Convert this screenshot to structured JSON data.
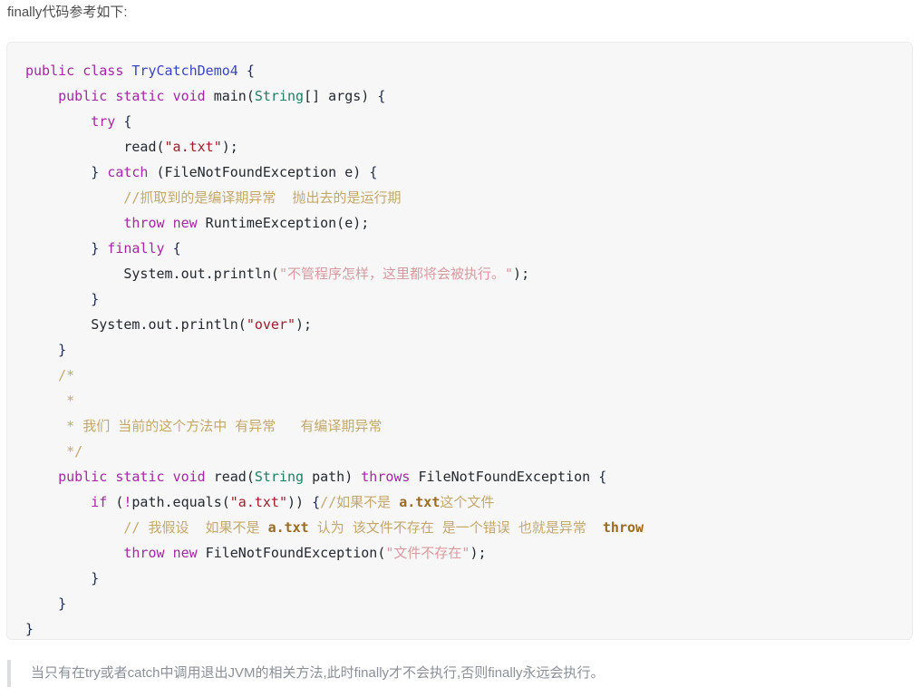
{
  "intro": {
    "text": "finally代码参考如下:"
  },
  "code_block": {
    "language": "java",
    "background_color": "#f7f7f8",
    "border_color": "#ececef",
    "colors": {
      "keyword": "#a626a4",
      "type_declaration": "#3b44c4",
      "builtin_type": "#1e8063",
      "string": "#a21b2b",
      "string_cjk": "#d99a9f",
      "comment": "#c4a86a",
      "comment_emphasis": "#9a6b23",
      "plain": "#24292e",
      "brace": "#1c2b4a"
    },
    "lines": [
      {
        "id": "line-1",
        "tokens": [
          {
            "t": "public",
            "c": "kw"
          },
          {
            "t": " ",
            "c": "pl"
          },
          {
            "t": "class",
            "c": "kw"
          },
          {
            "t": " ",
            "c": "pl"
          },
          {
            "t": "TryCatchDemo4",
            "c": "typ"
          },
          {
            "t": " ",
            "c": "pl"
          },
          {
            "t": "{",
            "c": "br"
          }
        ]
      },
      {
        "id": "line-2",
        "tokens": [
          {
            "t": "    ",
            "c": "pl"
          },
          {
            "t": "public",
            "c": "kw"
          },
          {
            "t": " ",
            "c": "pl"
          },
          {
            "t": "static",
            "c": "kw"
          },
          {
            "t": " ",
            "c": "pl"
          },
          {
            "t": "void",
            "c": "kw"
          },
          {
            "t": " ",
            "c": "pl"
          },
          {
            "t": "main",
            "c": "pl"
          },
          {
            "t": "(",
            "c": "pl"
          },
          {
            "t": "String",
            "c": "bi"
          },
          {
            "t": "[] args) ",
            "c": "pl"
          },
          {
            "t": "{",
            "c": "br"
          }
        ]
      },
      {
        "id": "line-3",
        "tokens": [
          {
            "t": "        ",
            "c": "pl"
          },
          {
            "t": "try",
            "c": "kw"
          },
          {
            "t": " ",
            "c": "pl"
          },
          {
            "t": "{",
            "c": "br"
          }
        ]
      },
      {
        "id": "line-4",
        "tokens": [
          {
            "t": "            read(",
            "c": "pl"
          },
          {
            "t": "\"a.txt\"",
            "c": "str"
          },
          {
            "t": ");",
            "c": "pl"
          }
        ]
      },
      {
        "id": "line-5",
        "tokens": [
          {
            "t": "        ",
            "c": "pl"
          },
          {
            "t": "}",
            "c": "br"
          },
          {
            "t": " ",
            "c": "pl"
          },
          {
            "t": "catch",
            "c": "kw"
          },
          {
            "t": " (FileNotFoundException e) ",
            "c": "pl"
          },
          {
            "t": "{",
            "c": "br"
          }
        ]
      },
      {
        "id": "line-6",
        "tokens": [
          {
            "t": "            ",
            "c": "pl"
          },
          {
            "t": "//抓取到的是编译期异常  抛出去的是运行期",
            "c": "cmt"
          }
        ]
      },
      {
        "id": "line-7",
        "tokens": [
          {
            "t": "            ",
            "c": "pl"
          },
          {
            "t": "throw",
            "c": "kw"
          },
          {
            "t": " ",
            "c": "pl"
          },
          {
            "t": "new",
            "c": "kw"
          },
          {
            "t": " RuntimeException(e);",
            "c": "pl"
          }
        ]
      },
      {
        "id": "line-8",
        "tokens": [
          {
            "t": "        ",
            "c": "pl"
          },
          {
            "t": "}",
            "c": "br"
          },
          {
            "t": " ",
            "c": "pl"
          },
          {
            "t": "finally",
            "c": "kw"
          },
          {
            "t": " ",
            "c": "pl"
          },
          {
            "t": "{",
            "c": "br"
          }
        ]
      },
      {
        "id": "line-9",
        "tokens": [
          {
            "t": "            System.out.println(",
            "c": "pl"
          },
          {
            "t": "\"不管程序怎样，这里都将会被执行。\"",
            "c": "strc"
          },
          {
            "t": ");",
            "c": "pl"
          }
        ]
      },
      {
        "id": "line-10",
        "tokens": [
          {
            "t": "        ",
            "c": "pl"
          },
          {
            "t": "}",
            "c": "br"
          }
        ]
      },
      {
        "id": "line-11",
        "tokens": [
          {
            "t": "        System.out.println(",
            "c": "pl"
          },
          {
            "t": "\"over\"",
            "c": "str"
          },
          {
            "t": ");",
            "c": "pl"
          }
        ]
      },
      {
        "id": "line-12",
        "tokens": [
          {
            "t": "    ",
            "c": "pl"
          },
          {
            "t": "}",
            "c": "br"
          }
        ]
      },
      {
        "id": "line-13",
        "tokens": [
          {
            "t": "    ",
            "c": "pl"
          },
          {
            "t": "/*",
            "c": "cmt"
          }
        ]
      },
      {
        "id": "line-14",
        "tokens": [
          {
            "t": "     ",
            "c": "pl"
          },
          {
            "t": "*",
            "c": "cmt"
          }
        ]
      },
      {
        "id": "line-15",
        "tokens": [
          {
            "t": "     ",
            "c": "pl"
          },
          {
            "t": "* 我们 当前的这个方法中 有异常   有编译期异常",
            "c": "cmt"
          }
        ]
      },
      {
        "id": "line-16",
        "tokens": [
          {
            "t": "     ",
            "c": "pl"
          },
          {
            "t": "*/",
            "c": "cmt"
          }
        ]
      },
      {
        "id": "line-17",
        "tokens": [
          {
            "t": "    ",
            "c": "pl"
          },
          {
            "t": "public",
            "c": "kw"
          },
          {
            "t": " ",
            "c": "pl"
          },
          {
            "t": "static",
            "c": "kw"
          },
          {
            "t": " ",
            "c": "pl"
          },
          {
            "t": "void",
            "c": "kw"
          },
          {
            "t": " ",
            "c": "pl"
          },
          {
            "t": "read",
            "c": "pl"
          },
          {
            "t": "(",
            "c": "pl"
          },
          {
            "t": "String",
            "c": "bi"
          },
          {
            "t": " path) ",
            "c": "pl"
          },
          {
            "t": "throws",
            "c": "kw"
          },
          {
            "t": " FileNotFoundException ",
            "c": "pl"
          },
          {
            "t": "{",
            "c": "br"
          }
        ]
      },
      {
        "id": "line-18",
        "tokens": [
          {
            "t": "        ",
            "c": "pl"
          },
          {
            "t": "if",
            "c": "kw"
          },
          {
            "t": " (",
            "c": "pl"
          },
          {
            "t": "!",
            "c": "kw"
          },
          {
            "t": "path.equals(",
            "c": "pl"
          },
          {
            "t": "\"a.txt\"",
            "c": "str"
          },
          {
            "t": ")) ",
            "c": "pl"
          },
          {
            "t": "{",
            "c": "br"
          },
          {
            "t": "//如果不是 ",
            "c": "cmt"
          },
          {
            "t": "a.txt",
            "c": "cmtb"
          },
          {
            "t": "这个文件",
            "c": "cmt"
          }
        ]
      },
      {
        "id": "line-19",
        "tokens": [
          {
            "t": "            ",
            "c": "pl"
          },
          {
            "t": "// 我假设  如果不是 ",
            "c": "cmt"
          },
          {
            "t": "a.txt",
            "c": "cmtb"
          },
          {
            "t": " 认为 该文件不存在 是一个错误 也就是异常  ",
            "c": "cmt"
          },
          {
            "t": "throw",
            "c": "cmtb"
          }
        ]
      },
      {
        "id": "line-20",
        "tokens": [
          {
            "t": "            ",
            "c": "pl"
          },
          {
            "t": "throw",
            "c": "kw"
          },
          {
            "t": " ",
            "c": "pl"
          },
          {
            "t": "new",
            "c": "kw"
          },
          {
            "t": " FileNotFoundException(",
            "c": "pl"
          },
          {
            "t": "\"文件不存在\"",
            "c": "strc"
          },
          {
            "t": ");",
            "c": "pl"
          }
        ]
      },
      {
        "id": "line-21",
        "tokens": [
          {
            "t": "        ",
            "c": "pl"
          },
          {
            "t": "}",
            "c": "br"
          }
        ]
      },
      {
        "id": "line-22",
        "tokens": [
          {
            "t": "    ",
            "c": "pl"
          },
          {
            "t": "}",
            "c": "br"
          }
        ]
      },
      {
        "id": "line-23",
        "tokens": [
          {
            "t": "}",
            "c": "br"
          }
        ]
      }
    ]
  },
  "note": {
    "text": "当只有在try或者catch中调用退出JVM的相关方法,此时finally才不会执行,否则finally永远会执行。",
    "accent_color": "#dcdde0"
  }
}
